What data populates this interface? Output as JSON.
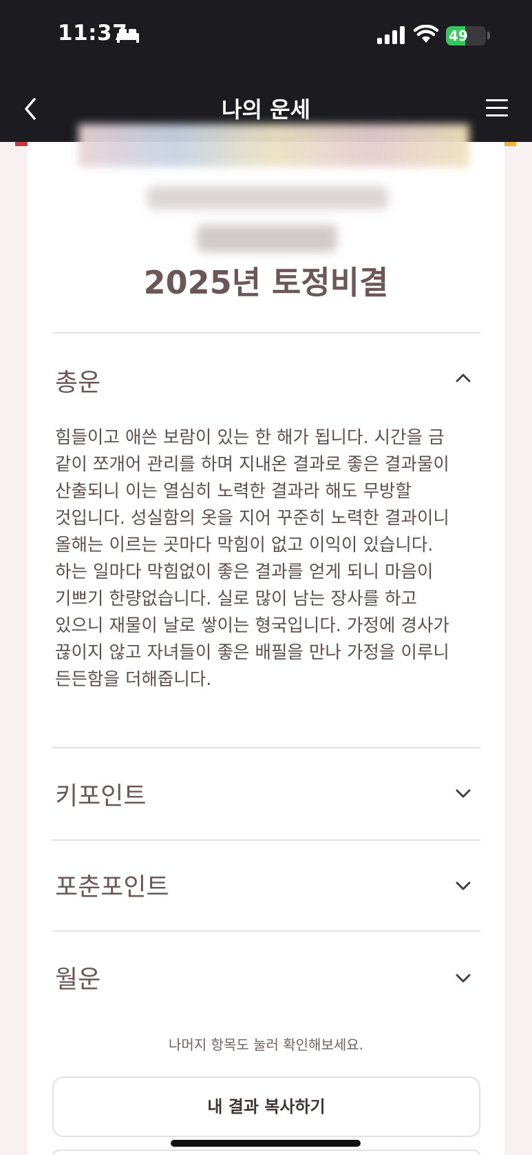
{
  "status_bar": {
    "time": "11:37",
    "battery_percent": 49,
    "battery_label": "49",
    "icons": [
      "bed-icon",
      "signal-icon",
      "wifi-icon",
      "battery-icon"
    ]
  },
  "header": {
    "title": "나의 운세",
    "back_icon": "chevron-left-icon",
    "menu_icon": "hamburger-menu-icon"
  },
  "colors": {
    "header_bg": "#1c1c20",
    "accent_red": "#c6383b",
    "accent_yellow": "#f2b632",
    "battery_green": "#34c759",
    "title_text": "#6b5757"
  },
  "card": {
    "title": "2025년 토정비결"
  },
  "sections": [
    {
      "title": "총운",
      "expanded": true,
      "body": "힘들이고 애쓴 보람이 있는 한 해가 됩니다. 시간을 금 같이 쪼개어 관리를 하며 지내온 결과로 좋은 결과물이 산출되니 이는 열심히 노력한 결과라 해도 무방할 것입니다. 성실함의 옷을 지어 꾸준히 노력한 결과이니 올해는 이르는 곳마다 막힘이 없고 이익이 있습니다. 하는 일마다 막힘없이 좋은 결과를 얻게 되니 마음이 기쁘기 한량없습니다. 실로 많이 남는 장사를 하고 있으니 재물이 날로 쌓이는 형국입니다. 가정에 경사가 끊이지 않고 자녀들이 좋은 배필을 만나 가정을 이루니 든든함을 더해줍니다."
    },
    {
      "title": "키포인트",
      "expanded": false
    },
    {
      "title": "포춘포인트",
      "expanded": false
    },
    {
      "title": "월운",
      "expanded": false
    }
  ],
  "footer": {
    "hint": "나머지 항목도 눌러 확인해보세요.",
    "copy_button": "내 결과 복사하기"
  }
}
